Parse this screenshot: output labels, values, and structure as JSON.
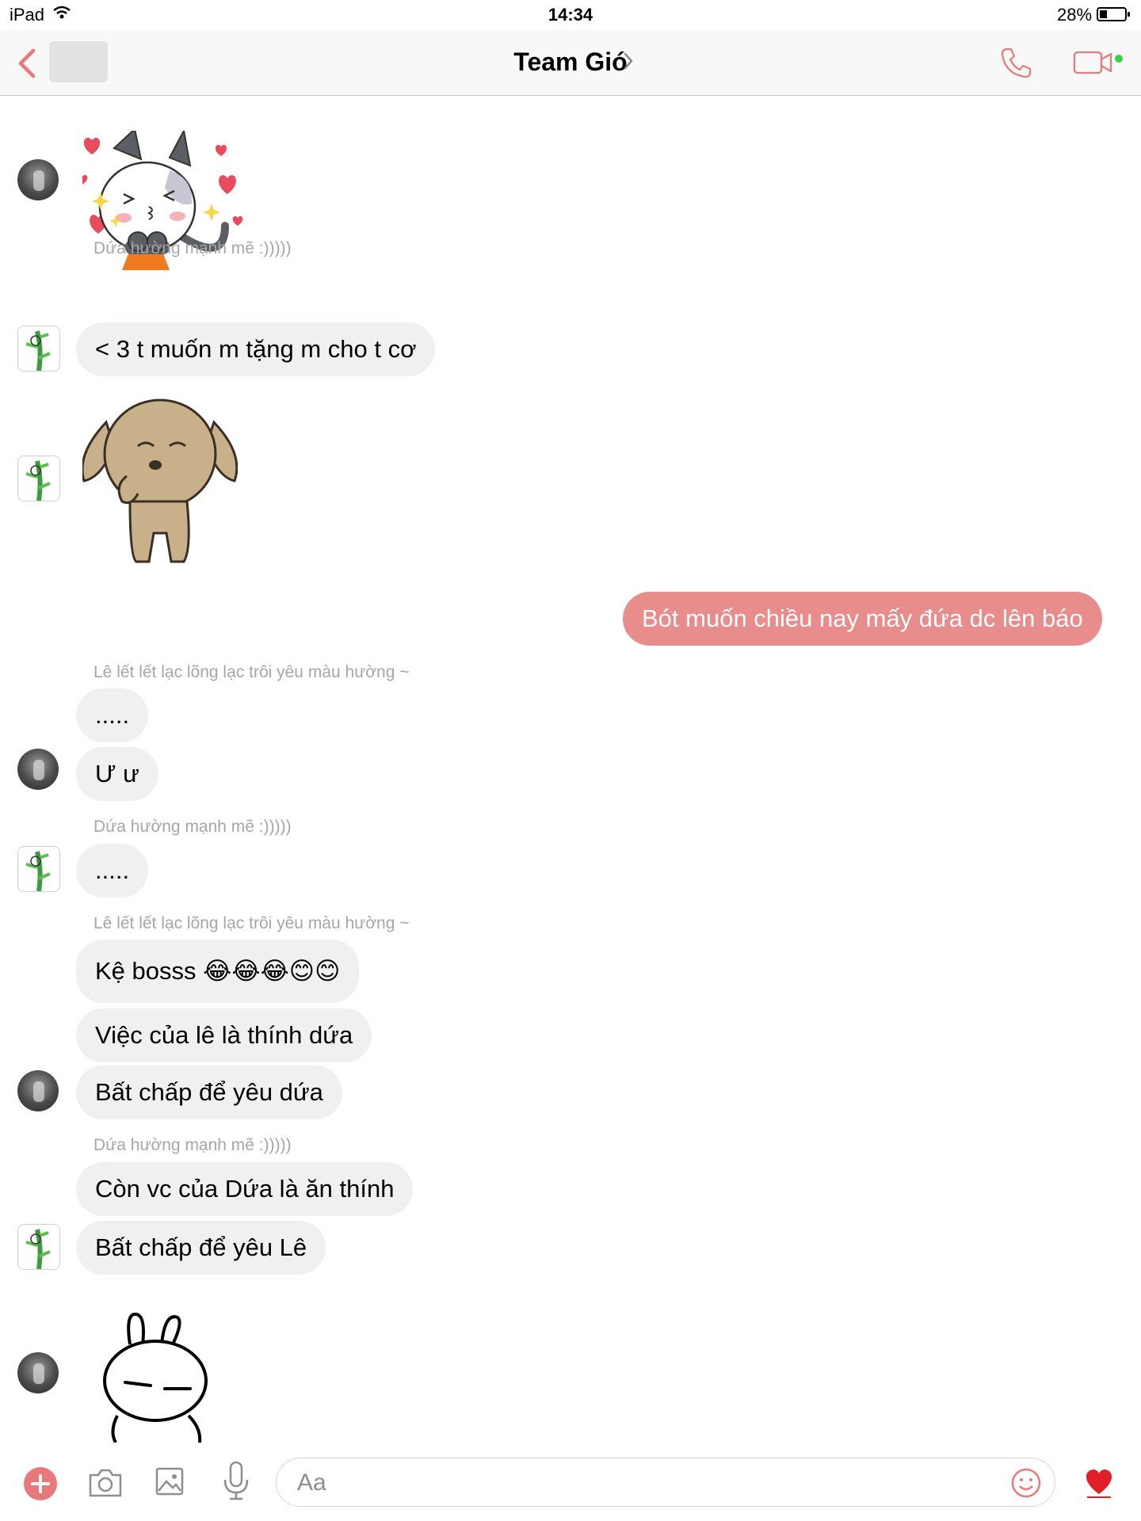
{
  "status_bar": {
    "carrier": "iPad",
    "time": "14:34",
    "battery": "28%"
  },
  "header": {
    "title": "Team Gió"
  },
  "messages": {
    "sender_1": "Dứa hường mạnh mẽ  :)))))",
    "bubble_1": "<   3 t muốn m tặng m cho t cơ",
    "bubble_out": "Bót muốn chiều nay mấy đứa dc lên báo",
    "sender_2": "Lê lết lết lạc lõng lạc trôi yêu màu hường ~",
    "bubble_2": ".....",
    "bubble_3": "Ư ư",
    "sender_3": "Dứa hường mạnh mẽ  :)))))",
    "bubble_4": ".....",
    "sender_4": "Lê lết lết lạc lõng lạc trôi yêu màu hường ~",
    "bubble_5": "Kệ bosss 😂😂😂😊😊",
    "bubble_6": "Việc của lê là thính dứa",
    "bubble_7": "Bất chấp để yêu dứa",
    "sender_5": "Dứa hường mạnh mẽ  :)))))",
    "bubble_8": "Còn vc của Dứa là ăn thính",
    "bubble_9": "Bất chấp để yêu Lê"
  },
  "composer": {
    "placeholder": "Aa"
  },
  "colors": {
    "accent": "#e8797a",
    "outgoing_bubble": "#e88c8c",
    "incoming_bubble": "#f0f0f0"
  }
}
